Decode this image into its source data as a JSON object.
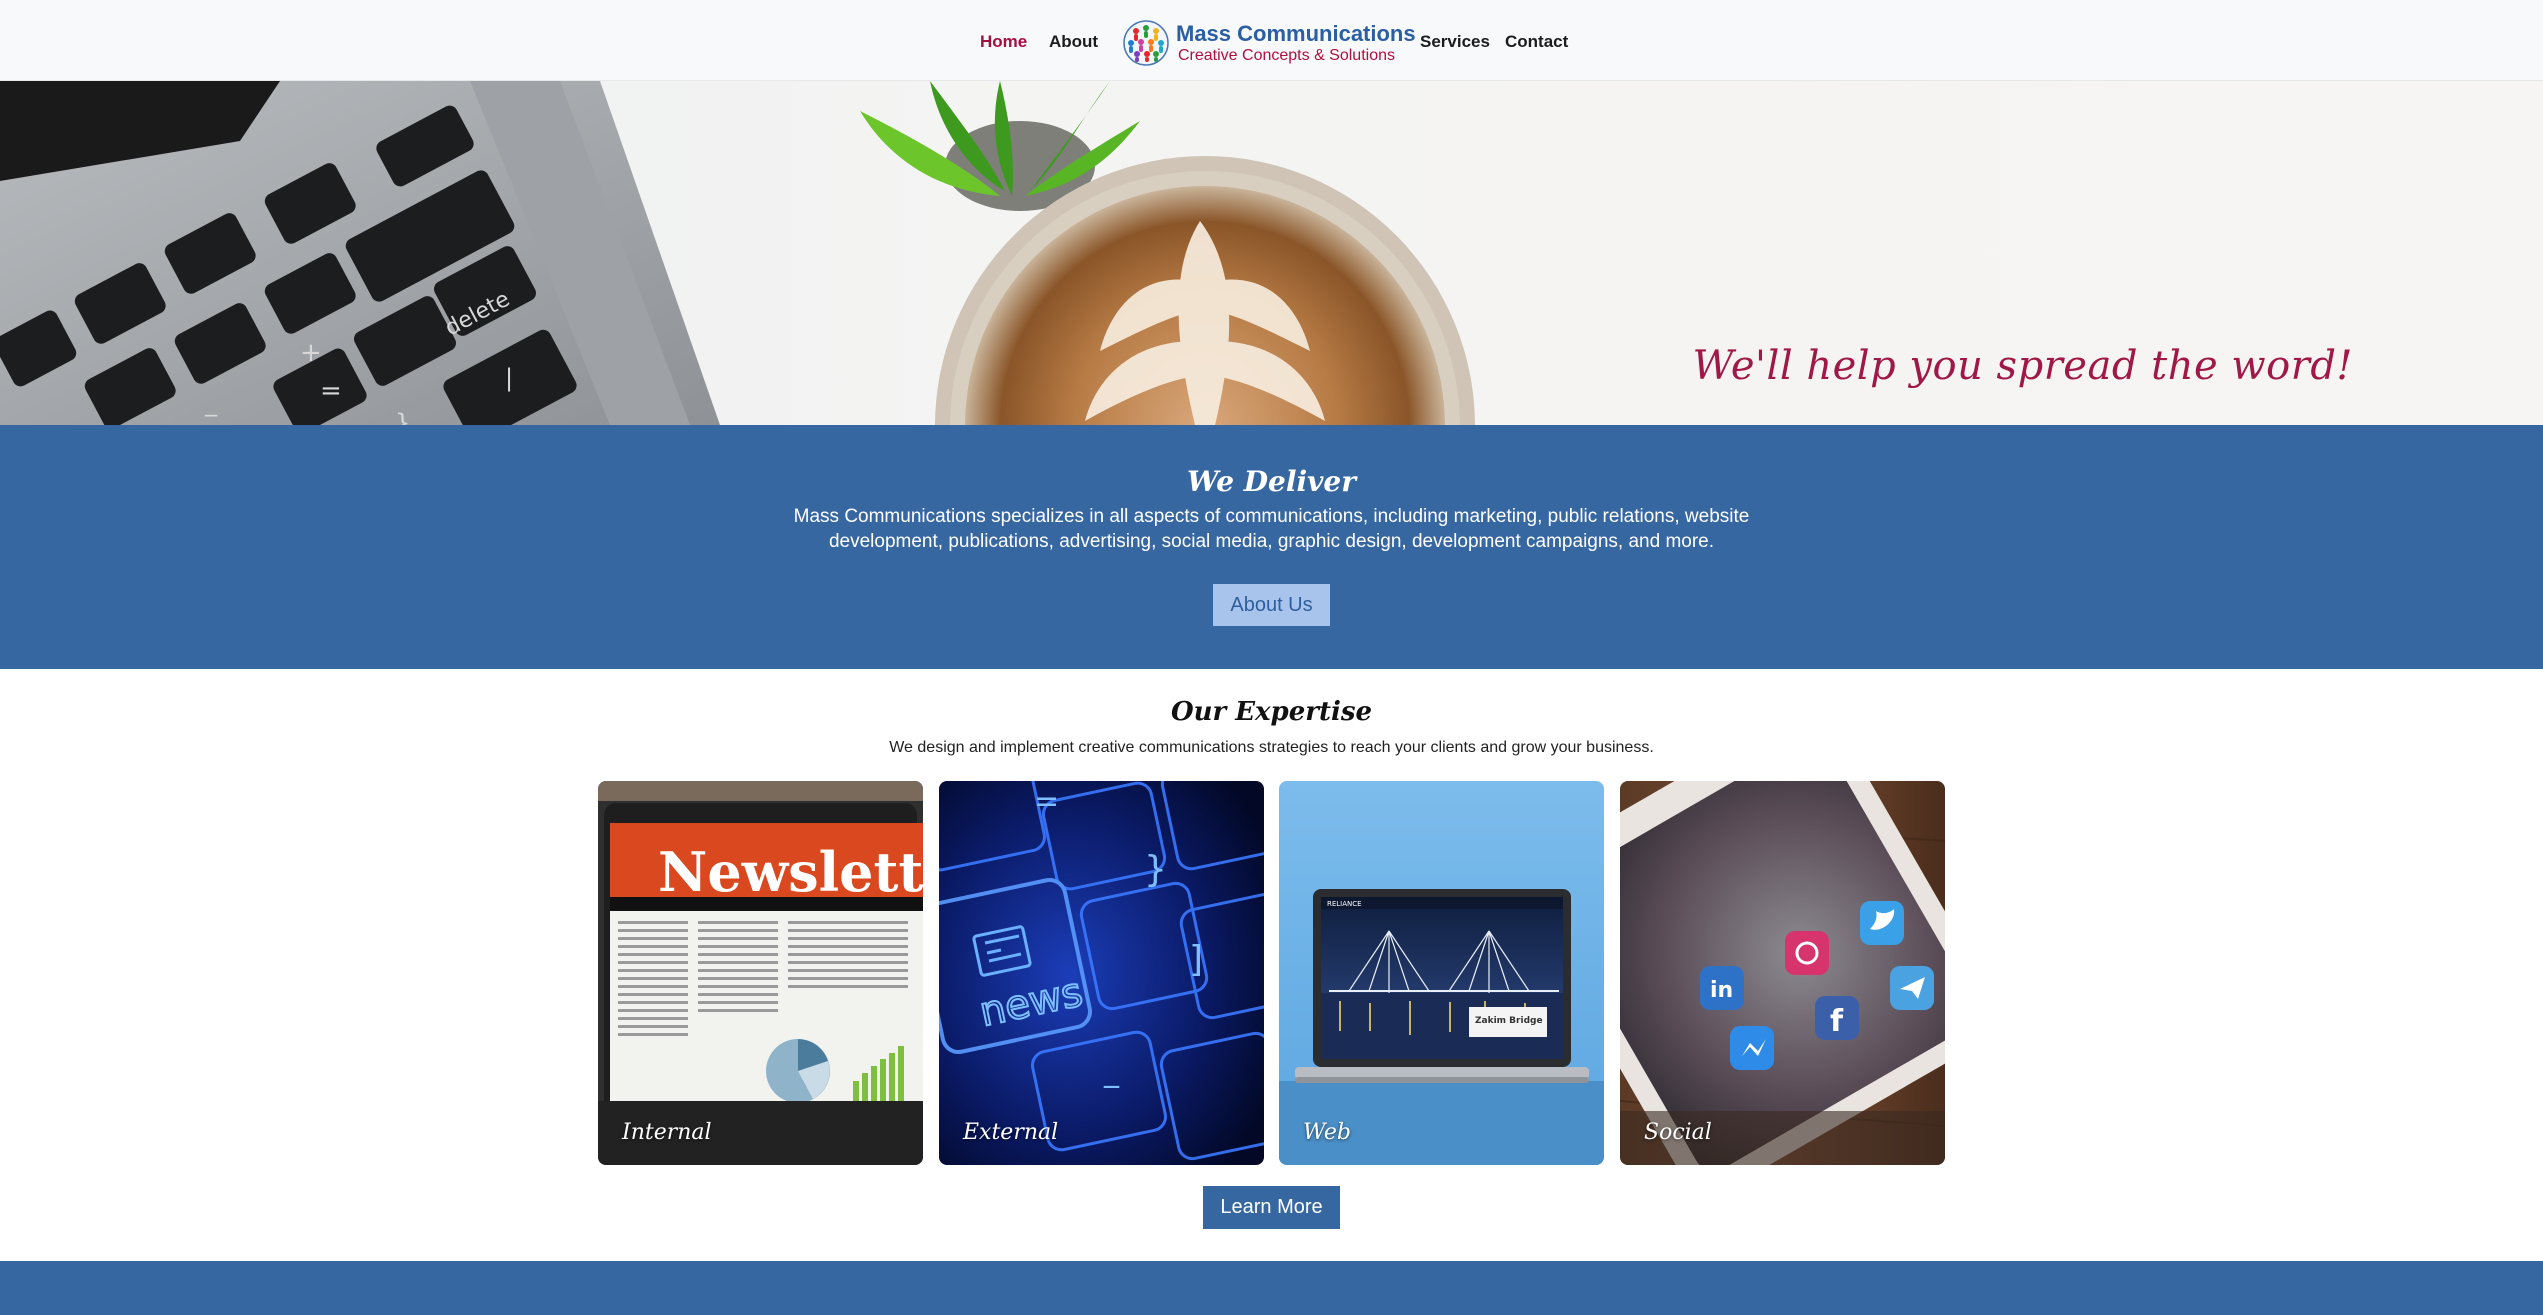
{
  "nav": {
    "links": [
      {
        "label": "Home",
        "active": true
      },
      {
        "label": "About"
      },
      {
        "label": "Services"
      },
      {
        "label": "Contact"
      }
    ],
    "brand": {
      "name": "Mass Communications",
      "tagline": "Creative Concepts & Solutions",
      "logo_icon": "globe-people-icon"
    }
  },
  "hero": {
    "tagline": "We'll help you spread the word!"
  },
  "deliver": {
    "title": "We Deliver",
    "text": "Mass Communications specializes in all aspects of communications, including marketing, public relations, website development, publications, advertising, social media, graphic design, development campaigns, and more.",
    "button_label": "About Us"
  },
  "expertise": {
    "title": "Our Expertise",
    "subtitle": "We design and implement creative communications strategies to reach your clients and grow your business.",
    "cards": [
      {
        "label": "Internal",
        "image_text": "Newsletter"
      },
      {
        "label": "External",
        "image_text": "news"
      },
      {
        "label": "Web",
        "image_text": "Zakim Bridge"
      },
      {
        "label": "Social"
      }
    ],
    "button_label": "Learn More"
  },
  "colors": {
    "brand_blue": "#3767a0",
    "accent_red": "#a3103f",
    "light_button": "#a9c4ec"
  }
}
